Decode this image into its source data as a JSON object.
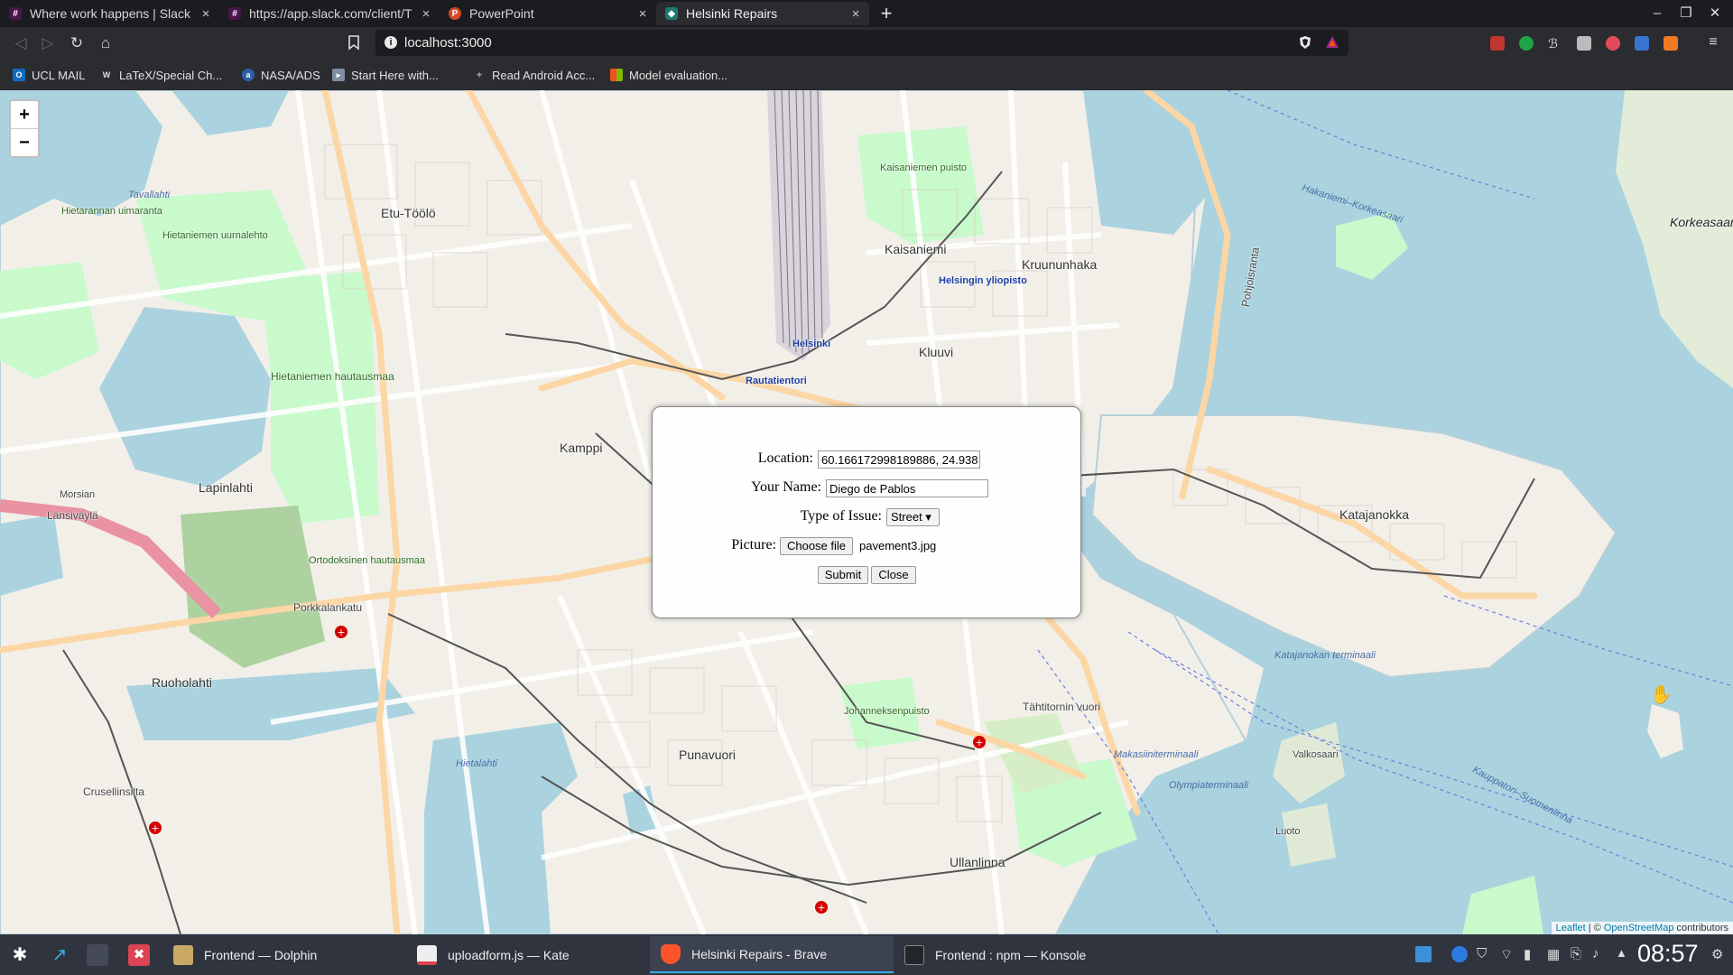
{
  "browser": {
    "tabs": [
      {
        "title": "Where work happens | Slack",
        "icon": "slack-icon",
        "active": false
      },
      {
        "title": "https://app.slack.com/client/T",
        "icon": "slack-icon",
        "active": false
      },
      {
        "title": "PowerPoint",
        "icon": "powerpoint-icon",
        "active": false
      },
      {
        "title": "Helsinki Repairs",
        "icon": "app-icon",
        "active": true
      }
    ],
    "url": "localhost:3000",
    "bookmarks": [
      {
        "label": "UCL MAIL",
        "icon": "outlook-icon"
      },
      {
        "label": "LaTeX/Special Ch...",
        "icon": "wikibooks-icon"
      },
      {
        "label": "NASA/ADS",
        "icon": "ads-icon"
      },
      {
        "label": "Start Here with...",
        "icon": "site-icon"
      },
      {
        "label": "Read Android Acc...",
        "icon": "android-icon"
      },
      {
        "label": "Model evaluation...",
        "icon": "windows-icon"
      }
    ]
  },
  "map": {
    "zoom_in": "+",
    "zoom_out": "−",
    "labels": {
      "etu_toolo": "Etu-Töölö",
      "kaisaniemi": "Kaisaniemi",
      "kaisaniemen_puisto": "Kaisaniemen puisto",
      "kruununhaka": "Kruununhaka",
      "kluuvi": "Kluuvi",
      "helsinki": "Helsinki",
      "rautatientori": "Rautatientori",
      "helsingin_yliopisto": "Helsingin yliopisto",
      "kamppi": "Kamppi",
      "lapinlahti": "Lapinlahti",
      "hietaniemen_hautausmaa": "Hietaniemen hautausmaa",
      "hietaniemen_uurnalehto": "Hietaniemen uurnalehto",
      "hietarannan_uimaranta": "Hietarannan uimaranta",
      "ortodoksinen_hautausmaa": "Ortodoksinen hautausmaa",
      "ruoholahti": "Ruoholahti",
      "punavuori": "Punavuori",
      "ullanlinna": "Ullanlinna",
      "katajanokka": "Katajanokka",
      "korkeasaari": "Korkeasaari",
      "tahtitornin_vuori": "Tähtitornin vuori",
      "crusellinsilta": "Crusellinsilta",
      "porkkalankatu": "Porkkalankatu",
      "lansivayla": "Länsiväylä",
      "pohjoisranta": "Pohjoisranta",
      "valkosaari": "Valkosaari",
      "luoto": "Luoto",
      "morsian": "Morsian",
      "tavallahti": "Tavallahti",
      "hietalahti": "Hietalahti",
      "johanneksenpuisto": "Johanneksenpuisto",
      "kauppatori_suomenlinna": "Kauppatori–Suomenlinna",
      "hakaniemi": "Hakaniemi–Korkeasaari",
      "katajanokan_terminaali": "Katajanokan terminaali",
      "olympiaterminaali": "Olympiaterminaali",
      "makasiiniterminaali": "Makasiiniterminaali"
    },
    "attribution": {
      "leaflet": "Leaflet",
      "separator": " | © ",
      "osm": "OpenStreetMap",
      "suffix": " contributors"
    }
  },
  "modal": {
    "location_label": "Location:",
    "location_value": "60.166172998189886, 24.938",
    "name_label": "Your Name:",
    "name_value": "Diego de Pablos",
    "issue_label": "Type of Issue:",
    "issue_value": "Street ▾",
    "picture_label": "Picture:",
    "choose_file": "Choose file",
    "file_name": "pavement3.jpg",
    "submit": "Submit",
    "close": "Close"
  },
  "taskbar": {
    "tasks": [
      {
        "label": "Frontend — Dolphin",
        "icon": "dolphin-icon",
        "active": false
      },
      {
        "label": "uploadform.js — Kate",
        "icon": "kate-icon",
        "active": false
      },
      {
        "label": "Helsinki Repairs - Brave",
        "icon": "brave-icon",
        "active": true
      },
      {
        "label": "Frontend : npm — Konsole",
        "icon": "konsole-icon",
        "active": false
      }
    ],
    "clock": "08:57"
  },
  "colors": {
    "chrome_dark": "#1b1c1f",
    "chrome": "#2b2c30",
    "water": "#aad3df",
    "land": "#f2efe9",
    "park": "#c8facc",
    "road_major": "#fcd6a4",
    "motorway": "#e892a2",
    "taskbar": "#2f343f",
    "accent": "#3daee9"
  }
}
